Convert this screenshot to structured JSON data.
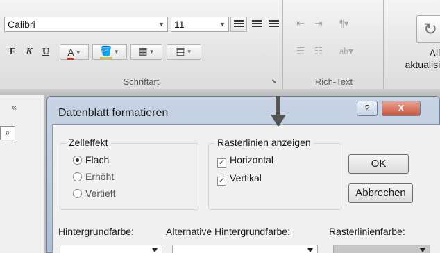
{
  "ribbon": {
    "font_group": {
      "font_name": "Calibri",
      "font_size": "11",
      "bold": "F",
      "italic": "K",
      "underline": "U",
      "font_color_letter": "A",
      "label": "Schriftart"
    },
    "rich_text_group": {
      "label": "Rich-Text"
    },
    "refresh": {
      "line1": "Alle",
      "line2": "aktualisie"
    }
  },
  "nav": {
    "collapse": "«",
    "search_icon": "⌕"
  },
  "dialog": {
    "title": "Datenblatt formatieren",
    "help": "?",
    "close": "X",
    "cell_effect": {
      "legend": "Zelleffekt",
      "options": [
        "Flach",
        "Erhöht",
        "Vertieft"
      ],
      "selected": "Flach"
    },
    "gridlines": {
      "legend": "Rasterlinien anzeigen",
      "horizontal": "Horizontal",
      "vertical": "Vertikal",
      "horizontal_checked": true,
      "vertical_checked": true
    },
    "ok": "OK",
    "cancel": "Abbrechen",
    "background_color_label": "Hintergrundfarbe:",
    "alt_background_color_label": "Alternative Hintergrundfarbe:",
    "gridline_color_label": "Rasterlinienfarbe:"
  }
}
